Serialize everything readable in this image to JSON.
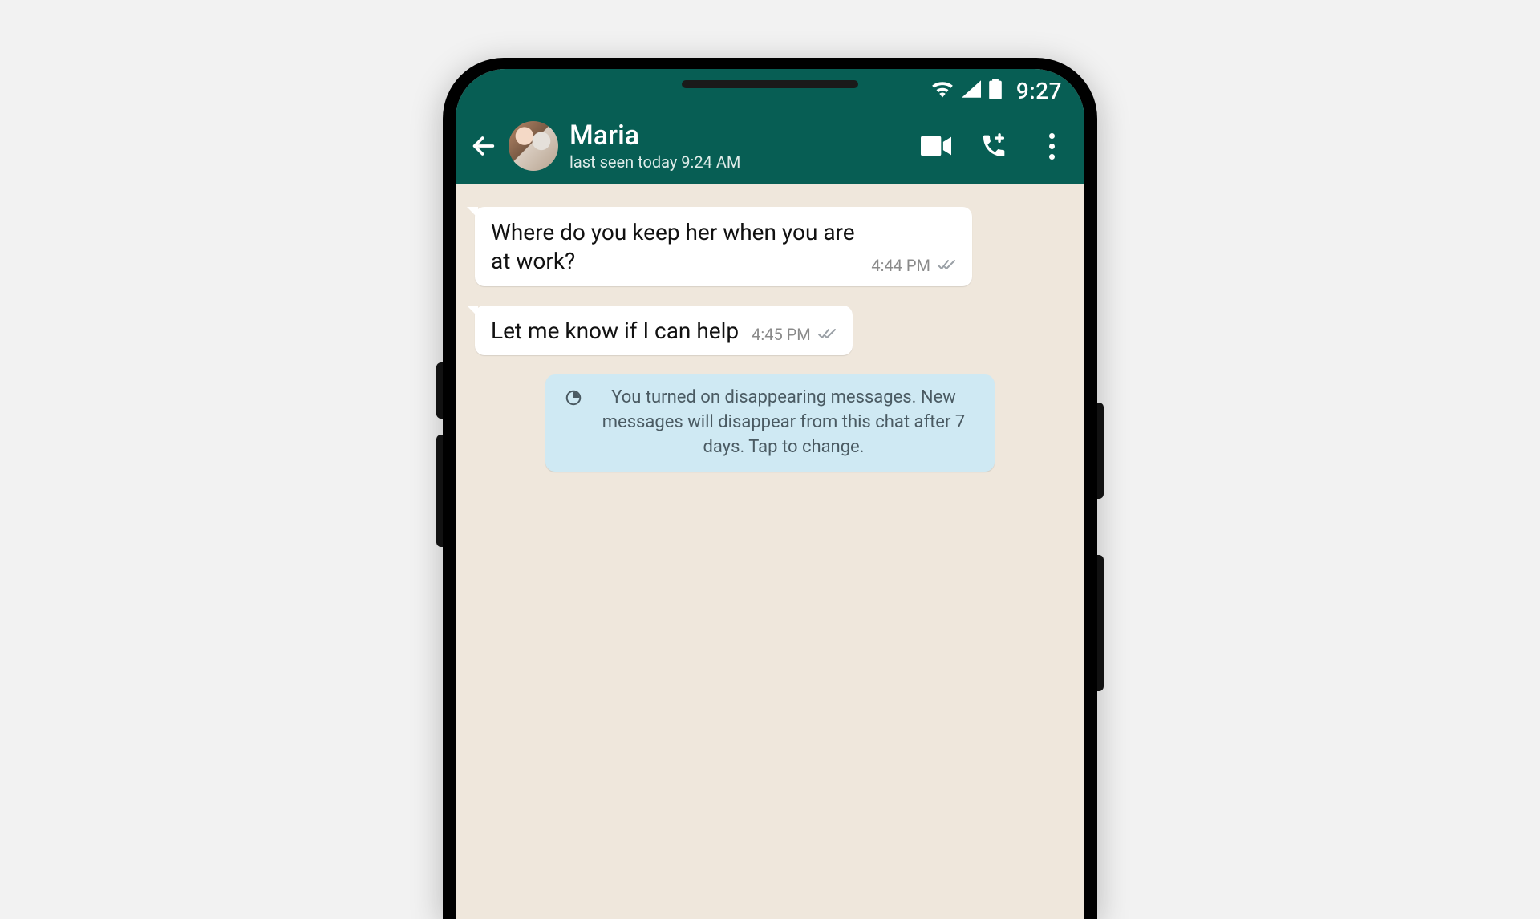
{
  "status": {
    "time": "9:27"
  },
  "header": {
    "contact_name": "Maria",
    "last_seen": "last seen today 9:24 AM"
  },
  "messages": [
    {
      "text": "Where do you keep her when you are at work?",
      "time": "4:44 PM"
    },
    {
      "text": "Let me know if I can help",
      "time": "4:45 PM"
    }
  ],
  "system_notice": "You turned on disappearing messages. New messages will disappear from this chat after 7 days. Tap to change."
}
